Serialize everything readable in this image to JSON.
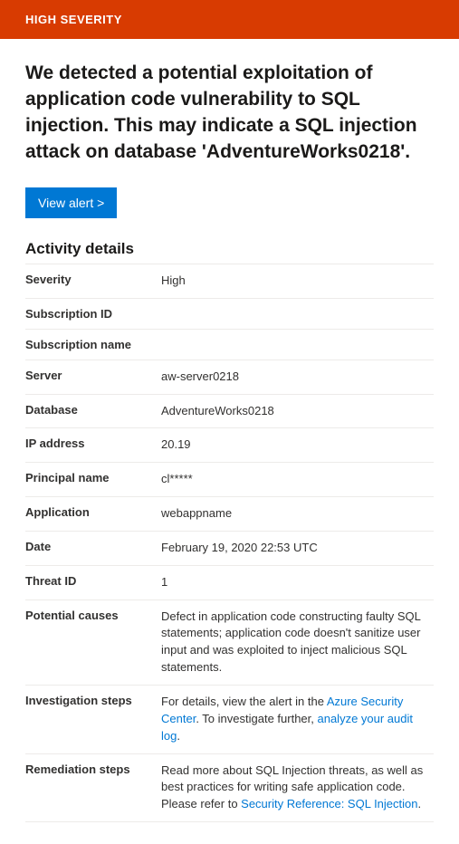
{
  "banner": {
    "severity_label": "HIGH SEVERITY"
  },
  "alert": {
    "title": "We detected a potential exploitation of application code vulnerability to SQL injection. This may indicate a SQL injection attack on database 'AdventureWorks0218'.",
    "view_button": "View alert >"
  },
  "section_title": "Activity details",
  "details": {
    "severity": {
      "label": "Severity",
      "value": "High"
    },
    "subscription_id": {
      "label": "Subscription ID",
      "value": ""
    },
    "subscription_name": {
      "label": "Subscription name",
      "value": ""
    },
    "server": {
      "label": "Server",
      "value": "aw-server0218"
    },
    "database": {
      "label": "Database",
      "value": "AdventureWorks0218"
    },
    "ip_address": {
      "label": "IP address",
      "value": "20.19"
    },
    "principal_name": {
      "label": "Principal name",
      "value": "cl*****"
    },
    "application": {
      "label": "Application",
      "value": "webappname"
    },
    "date": {
      "label": "Date",
      "value": "February 19, 2020 22:53 UTC"
    },
    "threat_id": {
      "label": "Threat ID",
      "value": "1"
    },
    "potential_causes": {
      "label": "Potential causes",
      "value": "Defect in application code constructing faulty SQL statements; application code doesn't sanitize user input and was exploited to inject malicious SQL statements."
    },
    "investigation_steps": {
      "label": "Investigation steps",
      "prefix": "For details, view the alert in the ",
      "link1": "Azure Security Center",
      "middle": ". To investigate further, ",
      "link2": "analyze your audit log",
      "suffix": "."
    },
    "remediation_steps": {
      "label": "Remediation steps",
      "prefix": "Read more about SQL Injection threats, as well as best practices for writing safe application code. Please refer to ",
      "link": "Security Reference: SQL Injection",
      "suffix": "."
    }
  }
}
